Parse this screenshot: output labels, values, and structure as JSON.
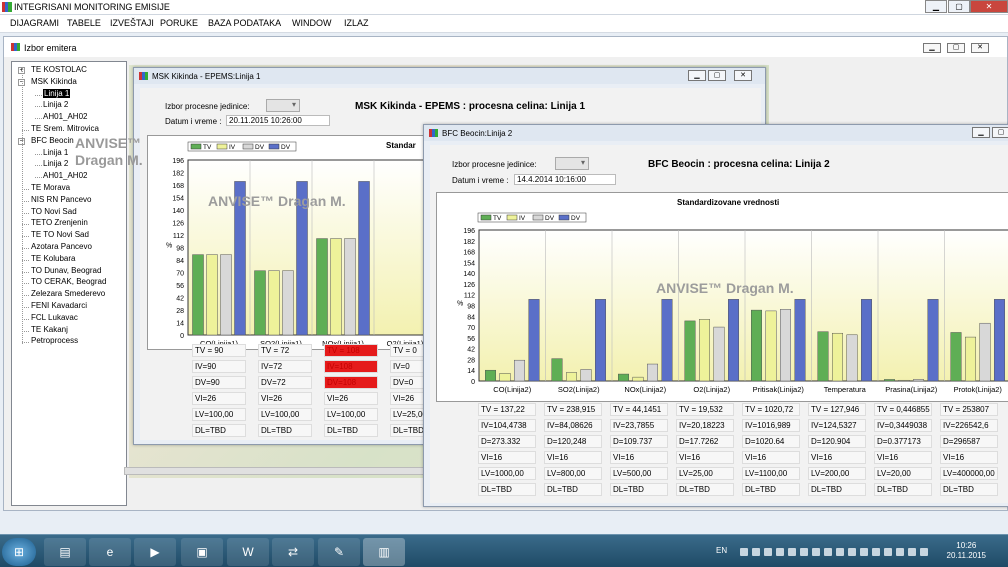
{
  "app": {
    "title": "INTEGRISANI MONITORING EMISIJE",
    "min_btn": "▁",
    "max_btn": "▢",
    "close_btn": "✕"
  },
  "menu": [
    "DIJAGRAMI",
    "TABELE",
    "IZVEŠTAJI",
    "PORUKE",
    "BAZA PODATAKA",
    "WINDOW",
    "IZLAZ"
  ],
  "mdi": {
    "title": "Izbor emitera"
  },
  "tree": [
    {
      "label": "TE KOSTOLAC",
      "exp": "+"
    },
    {
      "label": "MSK Kikinda",
      "exp": "−"
    },
    {
      "label": "Linija 1",
      "child": true,
      "selected": true
    },
    {
      "label": "Linija 2",
      "child": true
    },
    {
      "label": "AH01_AH02",
      "child": true
    },
    {
      "label": "TE Srem. Mitrovica"
    },
    {
      "label": "BFC Beocin",
      "exp": "−"
    },
    {
      "label": "Linija 1",
      "child": true
    },
    {
      "label": "Linija 2",
      "child": true
    },
    {
      "label": "AH01_AH02",
      "child": true
    },
    {
      "label": "TE Morava"
    },
    {
      "label": "NIS RN Pancevo"
    },
    {
      "label": "TO Novi Sad"
    },
    {
      "label": "TETO Zrenjenin"
    },
    {
      "label": "TE TO Novi Sad"
    },
    {
      "label": "Azotara Pancevo"
    },
    {
      "label": "TE Kolubara"
    },
    {
      "label": "TO Dunav, Beograd"
    },
    {
      "label": "TO CERAK, Beograd"
    },
    {
      "label": "Zelezara Smederevo"
    },
    {
      "label": "FENI Kavadarci"
    },
    {
      "label": "FCL Lukavac"
    },
    {
      "label": "TE Kakanj"
    },
    {
      "label": "Petroprocess"
    }
  ],
  "win1": {
    "title": "MSK Kikinda - EPEMS:Linija 1",
    "unit_label": "Izbor procesne jedinice:",
    "date_label": "Datum i vreme :",
    "date_value": "20.11.2015 10:26:00",
    "heading": "MSK Kikinda - EPEMS : procesna celina: Linija 1",
    "chart_title": "Standar",
    "watermark": "ANVISE™ Dragan M.",
    "watermark2": "ANVISE™",
    "watermark3": "Dragan M.",
    "y_label": "%",
    "columns": [
      {
        "cat": "CO(Linija1)",
        "cells": [
          "TV = 90",
          "IV=90",
          "DV=90",
          "VI=26",
          "LV=100,00",
          "DL=TBD"
        ],
        "red": [
          false,
          false,
          false,
          false,
          false,
          false
        ]
      },
      {
        "cat": "SO2(Linija1)",
        "cells": [
          "TV = 72",
          "IV=72",
          "DV=72",
          "VI=26",
          "LV=100,00",
          "DL=TBD"
        ],
        "red": [
          false,
          false,
          false,
          false,
          false,
          false
        ]
      },
      {
        "cat": "NOx(Linija1)",
        "cells": [
          "TV = 108",
          "IV=108",
          "DV=108",
          "VI=26",
          "LV=100,00",
          "DL=TBD"
        ],
        "red": [
          true,
          true,
          true,
          false,
          false,
          false
        ]
      },
      {
        "cat": "O2(Linija1)",
        "cells": [
          "TV = 0",
          "IV=0",
          "DV=0",
          "VI=26",
          "LV=25,00",
          "DL=TBD"
        ],
        "red": [
          false,
          false,
          false,
          false,
          false,
          false
        ]
      }
    ]
  },
  "win2": {
    "title": "BFC Beocin:Linija 2",
    "unit_label": "Izbor procesne jedinice:",
    "date_label": "Datum i vreme :",
    "date_value": "14.4.2014 10:16:00",
    "heading": "BFC Beocin : procesna celina: Linija 2",
    "chart_title": "Standardizovane vrednosti",
    "watermark": "ANVISE™ Dragan M.",
    "y_label": "%",
    "columns": [
      {
        "cat": "CO(Linija2)",
        "cells": [
          "TV = 137,22",
          "IV=104,4738",
          "D=273.332",
          "VI=16",
          "LV=1000,00",
          "DL=TBD"
        ]
      },
      {
        "cat": "SO2(Linija2)",
        "cells": [
          "TV = 238,915",
          "IV=84,08626",
          "D=120,248",
          "VI=16",
          "LV=800,00",
          "DL=TBD"
        ]
      },
      {
        "cat": "NOx(Linija2)",
        "cells": [
          "TV = 44,1451",
          "IV=23,7855",
          "D=109.737",
          "VI=16",
          "LV=500,00",
          "DL=TBD"
        ]
      },
      {
        "cat": "O2(Linija2)",
        "cells": [
          "TV = 19,532",
          "IV=20,18223",
          "D=17.7262",
          "VI=16",
          "LV=25,00",
          "DL=TBD"
        ]
      },
      {
        "cat": "Pritisak(Linija2)",
        "cells": [
          "TV = 1020,72",
          "IV=1016,989",
          "D=1020.64",
          "VI=16",
          "LV=1100,00",
          "DL=TBD"
        ]
      },
      {
        "cat": "Temperatura",
        "cells": [
          "TV = 127,946",
          "IV=124,5327",
          "D=120.904",
          "VI=16",
          "LV=200,00",
          "DL=TBD"
        ]
      },
      {
        "cat": "Prasina(Linija2)",
        "cells": [
          "TV = 0,446855",
          "IV=0,3449038",
          "D=0.377173",
          "VI=16",
          "LV=20,00",
          "DL=TBD"
        ]
      },
      {
        "cat": "Protok(Linija2)",
        "cells": [
          "TV = 253807",
          "IV=226542,6",
          "D=296587",
          "VI=16",
          "LV=400000,00",
          "DL=TBD"
        ]
      }
    ]
  },
  "colors": {
    "TV": "#5fae55",
    "IV": "#eef29a",
    "DV": "#d8d8d8",
    "DV2": "#5a6fc8",
    "plot_bg1": "#ffffff",
    "plot_bg2": "#f3f1b0"
  },
  "chart_data": [
    {
      "type": "bar",
      "title": "",
      "categories": [
        "CO(Linija1)",
        "SO2(Linija1)",
        "NOx(Linija1)",
        "O2(Linija1)"
      ],
      "ylabel": "%",
      "ylim": [
        0,
        196
      ],
      "yticks": [
        0,
        14,
        28,
        42,
        56,
        70,
        84,
        98,
        112,
        126,
        140,
        154,
        168,
        182,
        196
      ],
      "legend": [
        "TV",
        "IV",
        "DV",
        "DV"
      ],
      "legend_position": "top-left",
      "series": [
        {
          "name": "TV",
          "values": [
            90,
            72,
            108,
            0
          ]
        },
        {
          "name": "IV",
          "values": [
            90,
            72,
            108,
            0
          ]
        },
        {
          "name": "DV",
          "values": [
            90,
            72,
            108,
            0
          ]
        },
        {
          "name": "DV",
          "values": [
            172,
            172,
            172,
            0
          ]
        }
      ]
    },
    {
      "type": "bar",
      "title": "Standardizovane vrednosti",
      "categories": [
        "CO(Linija2)",
        "SO2(Linija2)",
        "NOx(Linija2)",
        "O2(Linija2)",
        "Pritisak(Linija2)",
        "Temperatura",
        "Prasina(Linija2)",
        "Protok(Linija2)"
      ],
      "ylabel": "%",
      "ylim": [
        0,
        196
      ],
      "yticks": [
        0,
        14,
        28,
        42,
        56,
        70,
        84,
        98,
        112,
        126,
        140,
        154,
        168,
        182,
        196
      ],
      "legend": [
        "TV",
        "IV",
        "DV",
        "DV"
      ],
      "legend_position": "top-left",
      "series": [
        {
          "name": "TV",
          "values": [
            14,
            29,
            9,
            78,
            92,
            64,
            2,
            63
          ]
        },
        {
          "name": "IV",
          "values": [
            10,
            11,
            5,
            80,
            91,
            62,
            1,
            57
          ]
        },
        {
          "name": "DV",
          "values": [
            27,
            15,
            22,
            70,
            93,
            60,
            2,
            75
          ]
        },
        {
          "name": "DV",
          "values": [
            106,
            106,
            106,
            106,
            106,
            106,
            106,
            106
          ]
        }
      ]
    }
  ],
  "taskbar": {
    "lang": "EN",
    "time": "10:26",
    "date": "20.11.2015"
  }
}
